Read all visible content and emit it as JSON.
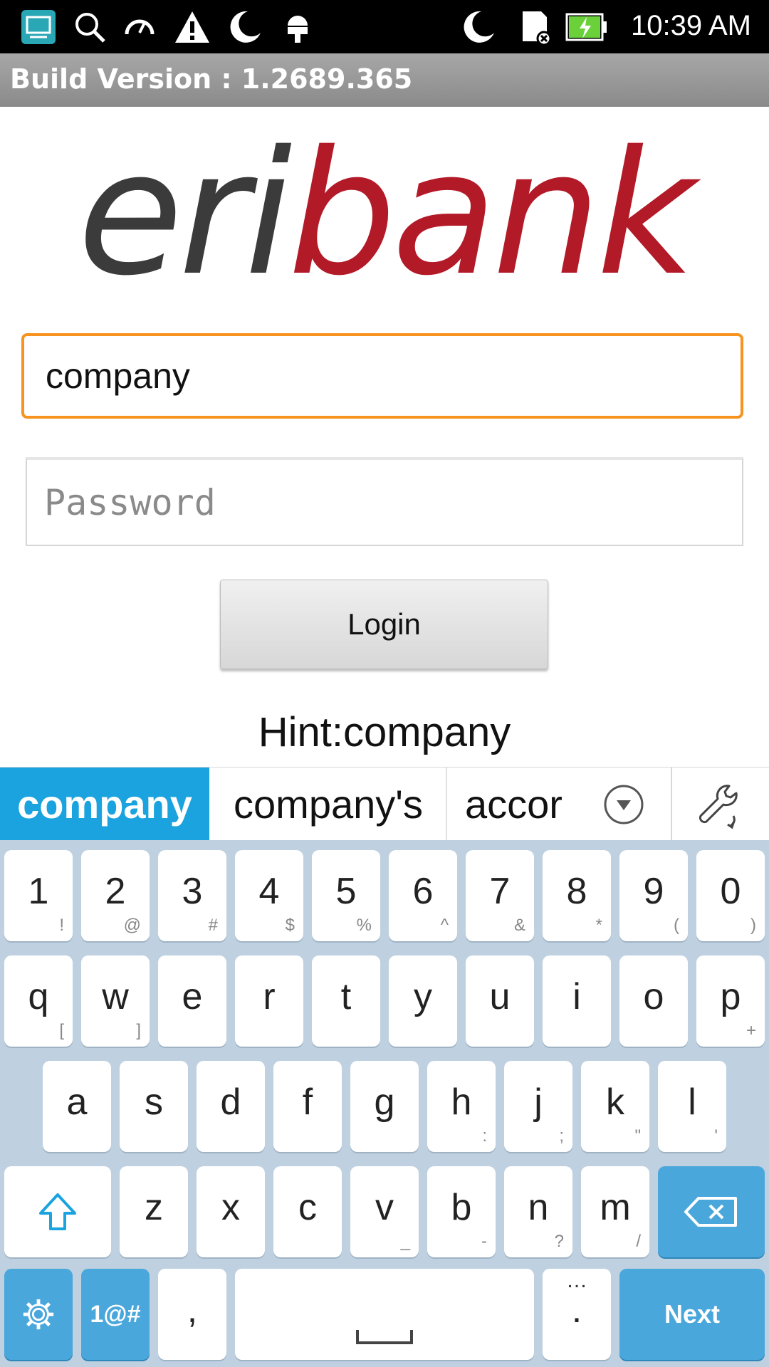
{
  "status_bar": {
    "time": "10:39 AM",
    "left_icons": [
      "screencast-icon",
      "search-icon",
      "speed-icon",
      "warning-icon",
      "moon-icon",
      "android-icon"
    ],
    "right_icons": [
      "moon-icon",
      "sd-card-icon",
      "battery-charging-icon"
    ]
  },
  "build_bar": {
    "text": "Build Version : 1.2689.365"
  },
  "logo": {
    "part1": "eri",
    "part2": "bank",
    "color1": "#3b3b3b",
    "color2": "#b31a28"
  },
  "form": {
    "username_value": "company",
    "password_placeholder": "Password",
    "login_label": "Login",
    "hint": "Hint:company",
    "focus_color": "#f7931e"
  },
  "suggestions": {
    "items": [
      "company",
      "company's",
      "accor"
    ],
    "more_icon": "chevron-down-icon",
    "tools_icon": "wrench-icon",
    "highlight_color": "#1aa3de"
  },
  "keyboard": {
    "row1": [
      {
        "k": "1",
        "s": "!"
      },
      {
        "k": "2",
        "s": "@"
      },
      {
        "k": "3",
        "s": "#"
      },
      {
        "k": "4",
        "s": "$"
      },
      {
        "k": "5",
        "s": "%"
      },
      {
        "k": "6",
        "s": "^"
      },
      {
        "k": "7",
        "s": "&"
      },
      {
        "k": "8",
        "s": "*"
      },
      {
        "k": "9",
        "s": "("
      },
      {
        "k": "0",
        "s": ")"
      }
    ],
    "row2": [
      {
        "k": "q",
        "s": "["
      },
      {
        "k": "w",
        "s": "]"
      },
      {
        "k": "e",
        "s": ""
      },
      {
        "k": "r",
        "s": ""
      },
      {
        "k": "t",
        "s": ""
      },
      {
        "k": "y",
        "s": ""
      },
      {
        "k": "u",
        "s": ""
      },
      {
        "k": "i",
        "s": ""
      },
      {
        "k": "o",
        "s": ""
      },
      {
        "k": "p",
        "s": "+"
      }
    ],
    "row3": [
      {
        "k": "a",
        "s": ""
      },
      {
        "k": "s",
        "s": ""
      },
      {
        "k": "d",
        "s": ""
      },
      {
        "k": "f",
        "s": ""
      },
      {
        "k": "g",
        "s": ""
      },
      {
        "k": "h",
        "s": ":"
      },
      {
        "k": "j",
        "s": ";"
      },
      {
        "k": "k",
        "s": "\""
      },
      {
        "k": "l",
        "s": "'"
      }
    ],
    "row4": [
      {
        "k": "z",
        "s": ""
      },
      {
        "k": "x",
        "s": ""
      },
      {
        "k": "c",
        "s": ""
      },
      {
        "k": "v",
        "s": "_"
      },
      {
        "k": "b",
        "s": "-"
      },
      {
        "k": "n",
        "s": "?"
      },
      {
        "k": "m",
        "s": "/"
      }
    ],
    "symbols_label": "1@#",
    "comma": ",",
    "period": ".",
    "period_secondary": "…",
    "next_label": "Next",
    "key_color": "#ffffff",
    "action_color": "#4aa7dc",
    "background_color": "#bfd1e0"
  }
}
